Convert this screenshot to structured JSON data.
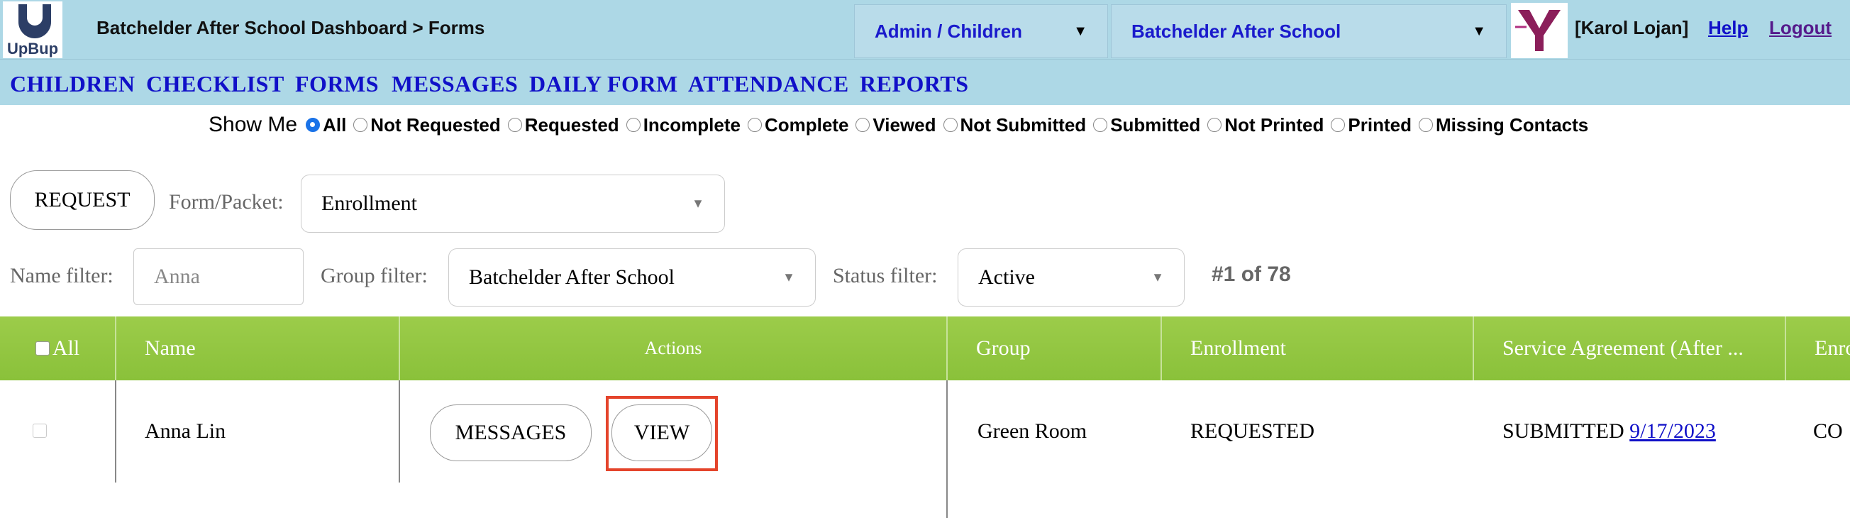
{
  "header": {
    "logo_text": "UpBup",
    "breadcrumb": "Batchelder After School Dashboard > Forms",
    "role_select": "Admin / Children",
    "site_select": "Batchelder After School",
    "user": "[Karol Lojan]",
    "help": "Help",
    "logout": "Logout"
  },
  "nav": [
    "CHILDREN",
    "CHECKLIST",
    "FORMS",
    "MESSAGES",
    "DAILY FORM",
    "ATTENDANCE",
    "REPORTS"
  ],
  "show_me": {
    "label": "Show Me",
    "options": [
      "All",
      "Not Requested",
      "Requested",
      "Incomplete",
      "Complete",
      "Viewed",
      "Not Submitted",
      "Submitted",
      "Not Printed",
      "Printed",
      "Missing Contacts"
    ],
    "selected": "All"
  },
  "request": {
    "button": "REQUEST",
    "form_label": "Form/Packet:",
    "form_value": "Enrollment"
  },
  "filters": {
    "name_label": "Name filter:",
    "name_placeholder": "Anna",
    "group_label": "Group filter:",
    "group_value": "Batchelder After School",
    "status_label": "Status filter:",
    "status_value": "Active",
    "count": "#1 of 78"
  },
  "table": {
    "headers": {
      "all": "All",
      "name": "Name",
      "actions": "Actions",
      "group": "Group",
      "enrollment": "Enrollment",
      "service": "Service Agreement (After ...",
      "next": "Enro"
    },
    "rows": [
      {
        "name": "Anna Lin",
        "messages_btn": "MESSAGES",
        "view_btn": "VIEW",
        "group": "Green Room",
        "enrollment": "REQUESTED",
        "service_status": "SUBMITTED",
        "service_date": "9/17/2023",
        "next": "CO"
      }
    ]
  },
  "colors": {
    "header_bg": "#add8e6",
    "nav_link": "#1010c8",
    "table_header": "#8ac13a",
    "highlight": "#e4442b"
  }
}
